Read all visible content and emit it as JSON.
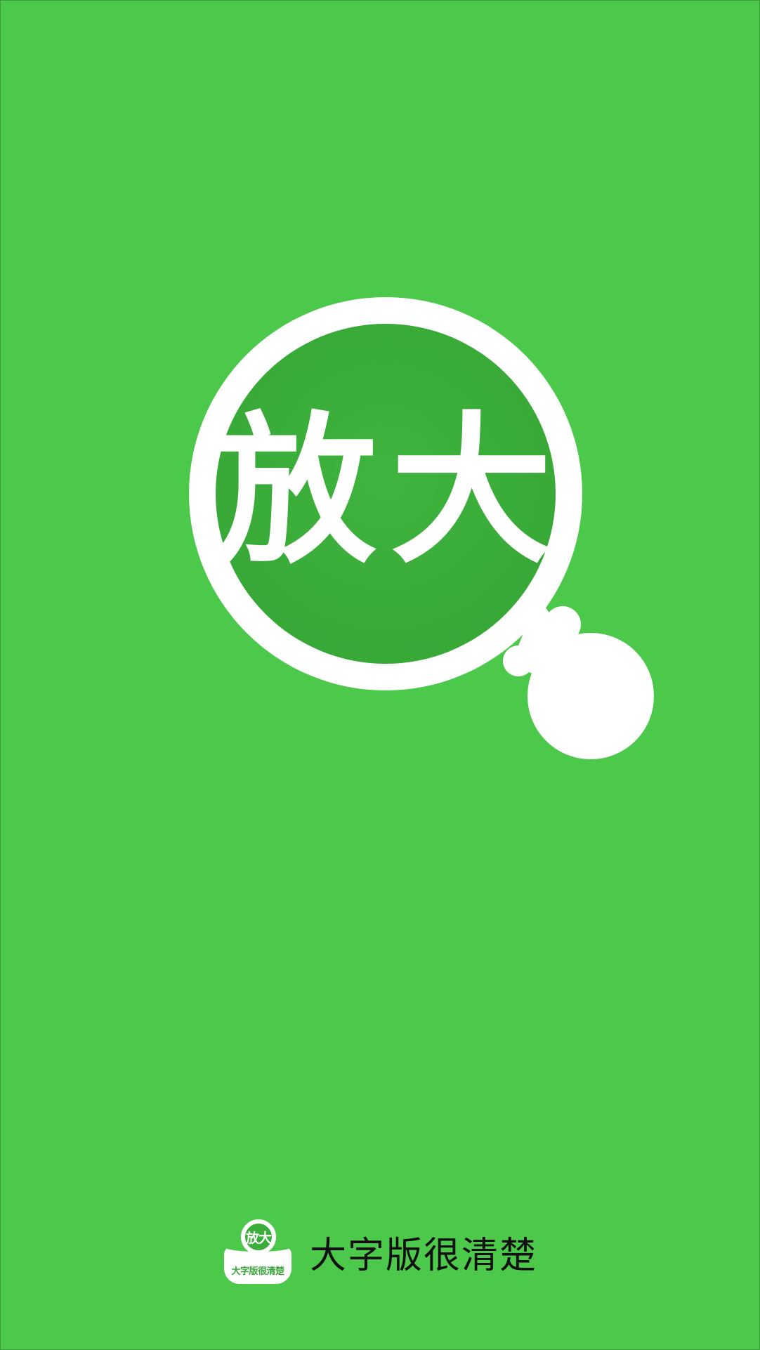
{
  "splash": {
    "lens_text": [
      "放",
      "大"
    ],
    "background_color": "#4cc84b",
    "lens_color": "#3aad3a",
    "ring_color": "#ffffff",
    "logo_icon": "magnifier-icon"
  },
  "brand": {
    "app_icon": {
      "ring_text": "放大",
      "caption": "大字版很清楚"
    },
    "title": "大字版很清楚"
  }
}
